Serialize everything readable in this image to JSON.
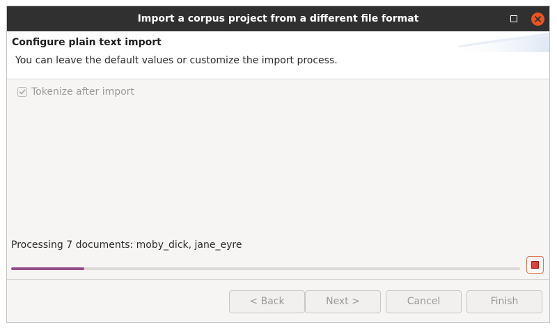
{
  "window": {
    "title": "Import a corpus project from a different file format"
  },
  "header": {
    "title": "Configure plain text import",
    "description": "You can leave the default values or customize the import process."
  },
  "options": {
    "tokenize_label": "Tokenize after import",
    "tokenize_checked": true
  },
  "progress": {
    "status_text": "Processing 7 documents: moby_dick, jane_eyre",
    "fraction": 0.143
  },
  "buttons": {
    "back": "< Back",
    "next": "Next >",
    "cancel": "Cancel",
    "finish": "Finish"
  },
  "colors": {
    "titlebar": "#303030",
    "close_button": "#e95420",
    "progress_fill": "#924d8b",
    "stop_button": "#e23c3c"
  }
}
